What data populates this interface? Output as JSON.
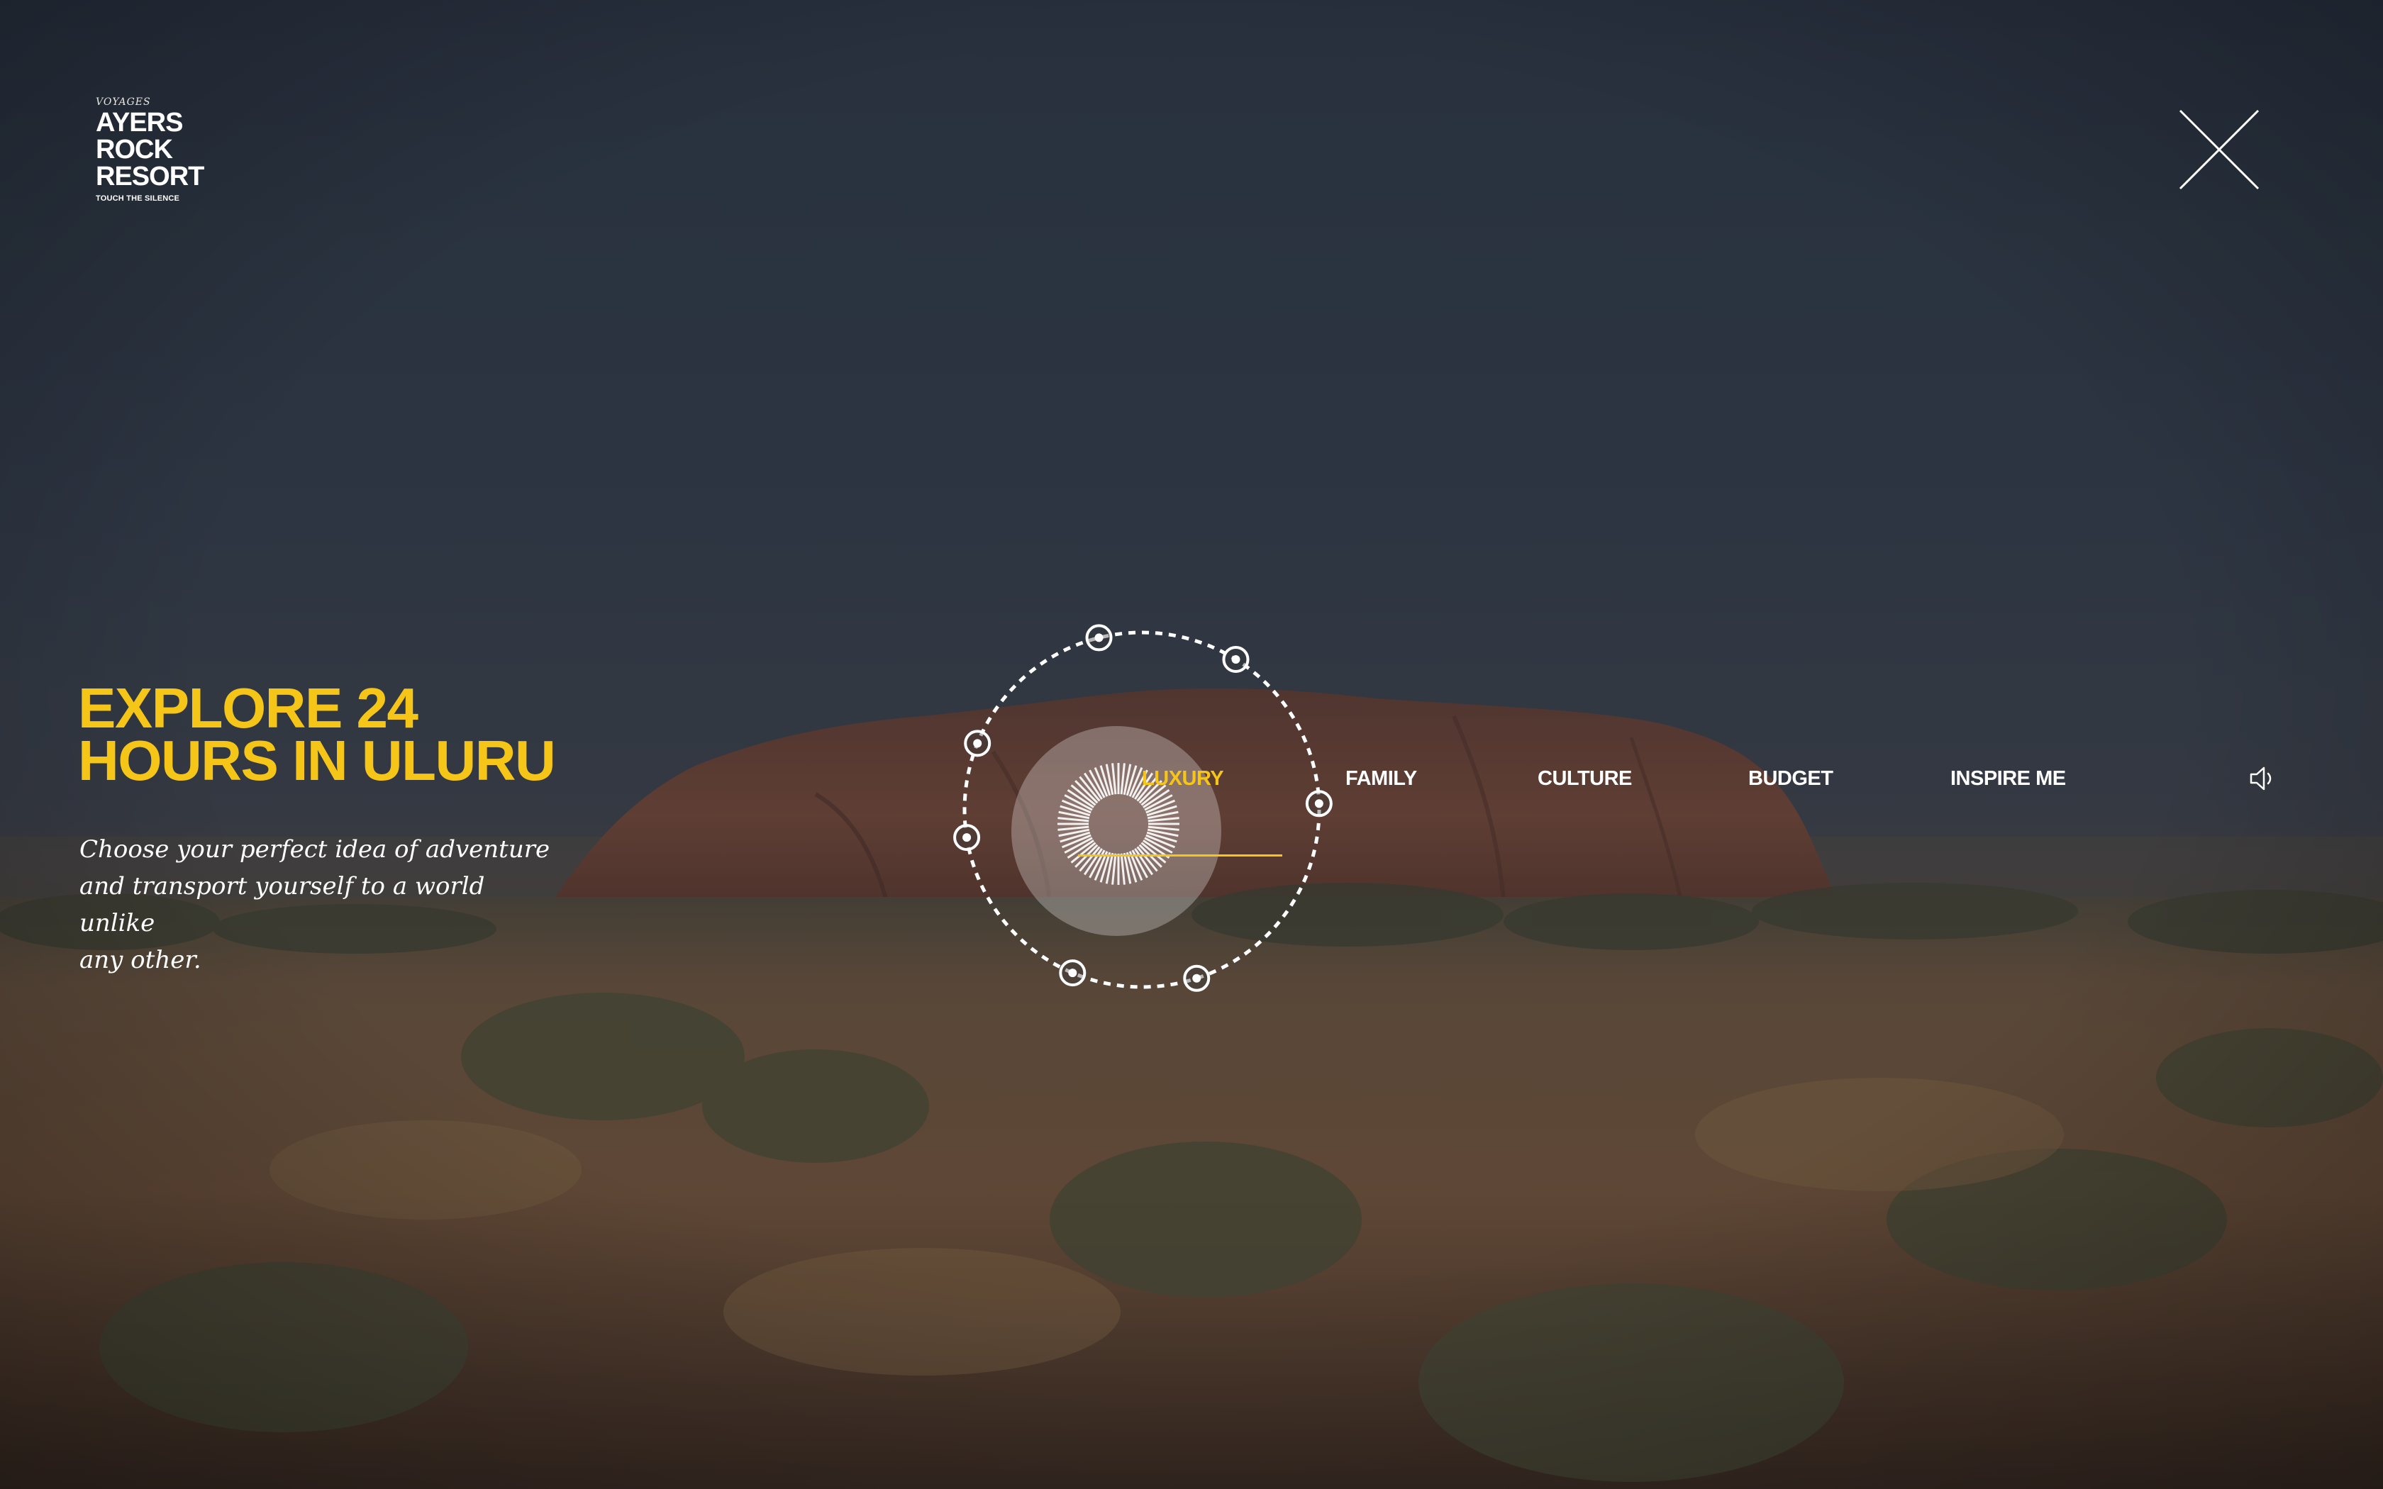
{
  "brand": {
    "tagline_top": "VOYAGES",
    "lines": [
      "AYERS",
      "ROCK",
      "RESORT"
    ],
    "tagline_bottom": "TOUCH THE SILENCE"
  },
  "hero": {
    "title_line1": "EXPLORE 24",
    "title_line2": "HOURS IN ULURU",
    "subtitle_line1": "Choose your perfect idea of adventure",
    "subtitle_line2": "and transport yourself to a world unlike",
    "subtitle_line3": "any other."
  },
  "nav": {
    "items": [
      {
        "label": "LUXURY",
        "active": true
      },
      {
        "label": "FAMILY",
        "active": false
      },
      {
        "label": "CULTURE",
        "active": false
      },
      {
        "label": "BUDGET",
        "active": false
      },
      {
        "label": "INSPIRE ME",
        "active": false
      }
    ]
  },
  "icons": {
    "close": "close-icon",
    "sound": "speaker-icon",
    "dial": "time-dial-icon"
  },
  "colors": {
    "accent": "#f5c518",
    "sky": "#2e3744",
    "rock": "#6b4032",
    "ground": "#7a5536"
  }
}
